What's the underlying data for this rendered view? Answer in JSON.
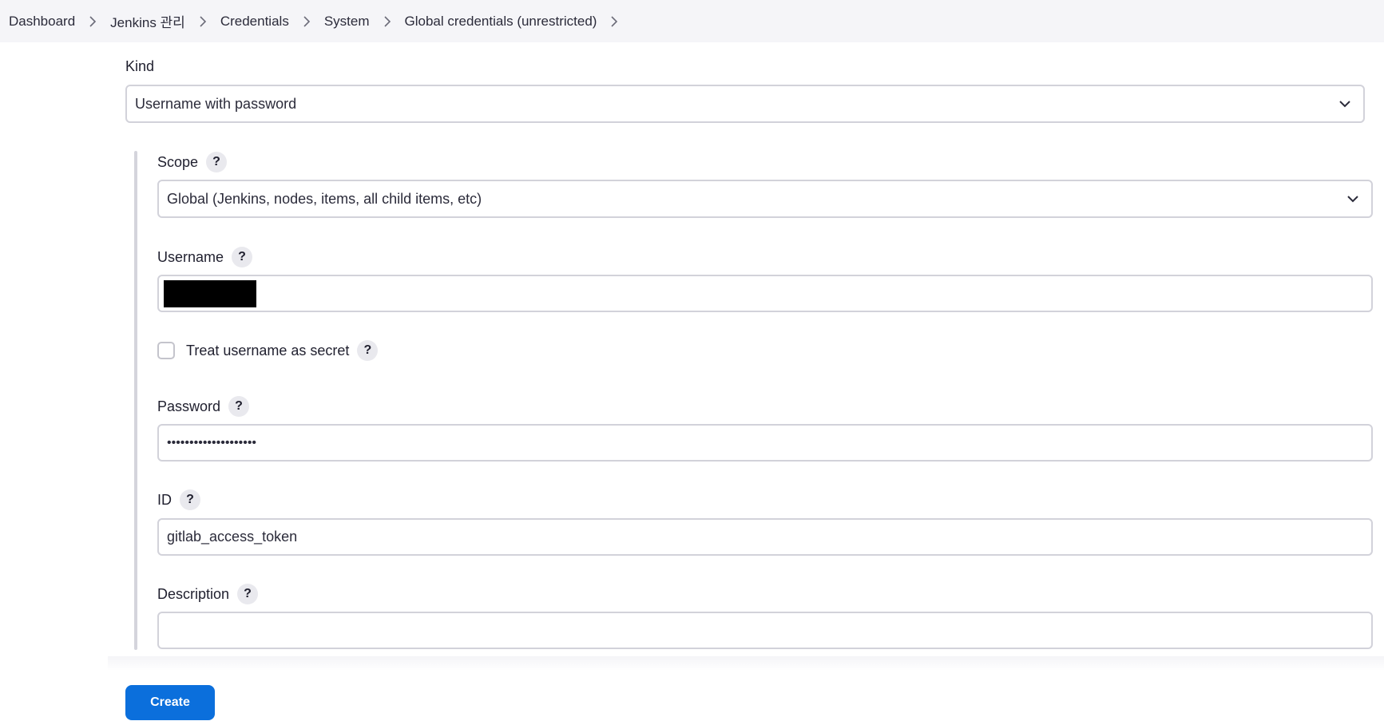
{
  "breadcrumb": {
    "items": [
      "Dashboard",
      "Jenkins 관리",
      "Credentials",
      "System",
      "Global credentials (unrestricted)"
    ]
  },
  "form": {
    "kind_label": "Kind",
    "kind_value": "Username with password",
    "scope_label": "Scope",
    "scope_value": "Global (Jenkins, nodes, items, all child items, etc)",
    "username_label": "Username",
    "treat_secret_label": "Treat username as secret",
    "password_label": "Password",
    "password_value": "••••••••••••••••••••",
    "id_label": "ID",
    "id_value": "gitlab_access_token",
    "description_label": "Description",
    "description_value": "",
    "help_glyph": "?",
    "create_label": "Create"
  },
  "icons": {
    "help": "question-mark-icon",
    "dropdown": "chevron-down-icon",
    "separator": "chevron-right-icon"
  },
  "colors": {
    "primary_button": "#0b6fdc",
    "breadcrumb_bg": "#f5f5f8",
    "border": "#d2d2da"
  }
}
